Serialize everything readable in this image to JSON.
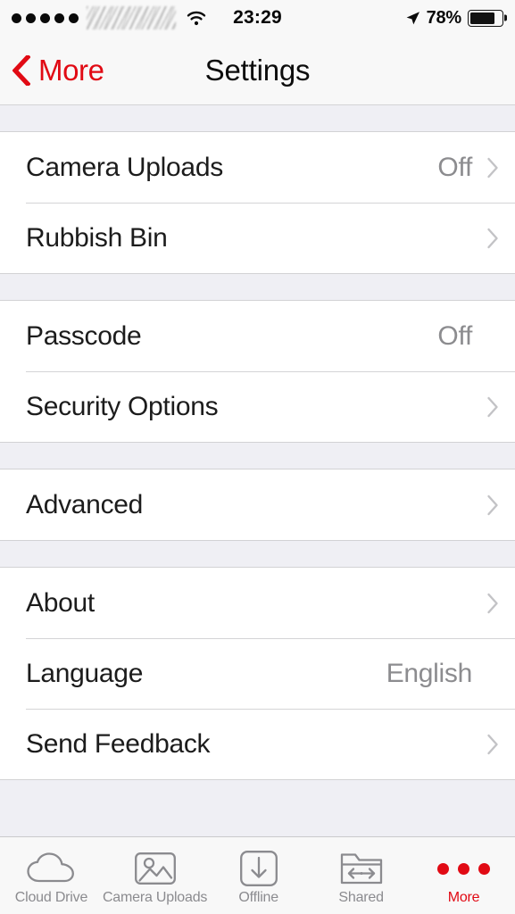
{
  "status_bar": {
    "signal_dots": 5,
    "carrier": "",
    "wifi_icon": "wifi-icon",
    "time": "23:29",
    "location_icon": "location-arrow-icon",
    "battery_percent": "78%",
    "battery_level": 78
  },
  "nav_bar": {
    "back_label": "More",
    "back_icon": "chevron-left-icon",
    "title": "Settings",
    "accent_color": "#e10a14"
  },
  "sections": [
    {
      "rows": [
        {
          "label": "Camera Uploads",
          "value": "Off",
          "chevron": true
        },
        {
          "label": "Rubbish Bin",
          "value": "",
          "chevron": true
        }
      ]
    },
    {
      "rows": [
        {
          "label": "Passcode",
          "value": "Off",
          "chevron": false
        },
        {
          "label": "Security Options",
          "value": "",
          "chevron": true
        }
      ]
    },
    {
      "rows": [
        {
          "label": "Advanced",
          "value": "",
          "chevron": true
        }
      ]
    },
    {
      "rows": [
        {
          "label": "About",
          "value": "",
          "chevron": true
        },
        {
          "label": "Language",
          "value": "English",
          "chevron": false
        },
        {
          "label": "Send Feedback",
          "value": "",
          "chevron": true
        }
      ]
    }
  ],
  "tab_bar": {
    "active": "More",
    "tabs": [
      {
        "label": "Cloud Drive",
        "icon": "cloud-icon",
        "active": false
      },
      {
        "label": "Camera Uploads",
        "icon": "photo-icon",
        "active": false
      },
      {
        "label": "Offline",
        "icon": "download-icon",
        "active": false
      },
      {
        "label": "Shared",
        "icon": "shared-folder-icon",
        "active": false
      },
      {
        "label": "More",
        "icon": "more-dots-icon",
        "active": true
      }
    ]
  },
  "colors": {
    "accent": "#e10a14",
    "group_background": "#ffffff",
    "page_background": "#efeff4",
    "separator": "#d4d4d6",
    "value_text": "#8c8c8f",
    "label_text": "#1c1c1c"
  }
}
